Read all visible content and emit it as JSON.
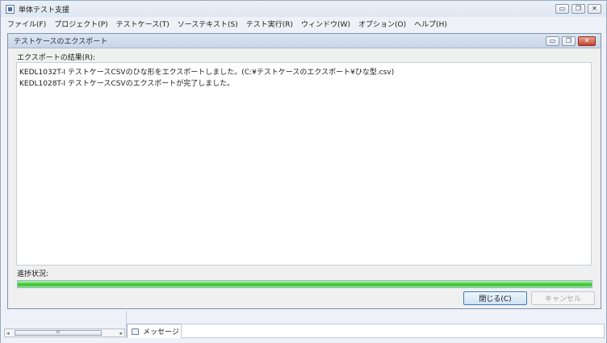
{
  "app": {
    "title": "単体テスト支援",
    "menu": [
      "ファイル(F)",
      "プロジェクト(P)",
      "テストケース(T)",
      "ソーステキスト(S)",
      "テスト実行(R)",
      "ウィンドウ(W)",
      "オプション(O)",
      "ヘルプ(H)"
    ]
  },
  "window_buttons": {
    "minimize": "▭",
    "restore": "❐",
    "close": "✕"
  },
  "dialog": {
    "title": "テストケースのエクスポート",
    "result_label": "エクスポートの結果(R):",
    "result_lines": [
      "KEDL1032T-I テストケースCSVのひな形をエクスポートしました。(C:¥テストケースのエクスポート¥ひな型.csv)",
      "KEDL1028T-I テストケースCSVのエクスポートが完了しました。"
    ],
    "progress_label": "進捗状況:",
    "progress_fraction": 1.0,
    "close_button": "閉じる(C)",
    "cancel_button": "キャンセル"
  },
  "bottom": {
    "scroll_left": "◂",
    "scroll_right": "▸",
    "scroll_thumb_grip": "III",
    "message_tab": "メッセージ"
  },
  "colors": {
    "progress_green": "#3ec43a",
    "close_button_border": "#3c7fb1",
    "close_red": "#c4412a"
  }
}
